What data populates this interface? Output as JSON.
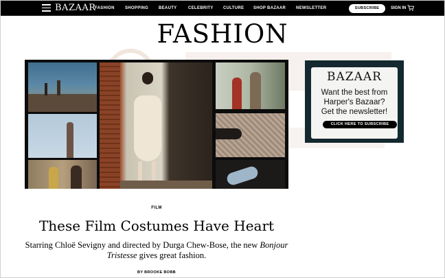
{
  "nav": {
    "logo": "BAZAAR",
    "links": [
      "FASHION",
      "SHOPPING",
      "BEAUTY",
      "CELEBRITY",
      "CULTURE",
      "SHOP BAZAAR",
      "NEWSLETTER"
    ],
    "subscribe_label": "SUBSCRIBE",
    "signin_label": "SIGN IN",
    "menu_icon": "hamburger-menu-icon",
    "cart_icon": "shopping-cart-icon"
  },
  "section": {
    "title": "FASHION"
  },
  "ad": {
    "logo": "BAZAAR",
    "line1": "Want the best from",
    "line2": "Harper's Bazaar?",
    "line3": "Get the newsletter!",
    "cta": "CLICK HERE TO SUBSCRIBE"
  },
  "article": {
    "kicker": "FILM",
    "headline": "These Film Costumes Have Heart",
    "dek_prefix": "Starring Chloë Sevigny and directed by Durga Chew-Bose, the new ",
    "dek_italic": "Bonjour Tristesse",
    "dek_suffix": " gives great fashion.",
    "byline": "BY BROOKE BOBB"
  },
  "colors": {
    "nav_bg": "#000000",
    "ad_bg": "#13282f",
    "page_bg": "#ffffff"
  }
}
